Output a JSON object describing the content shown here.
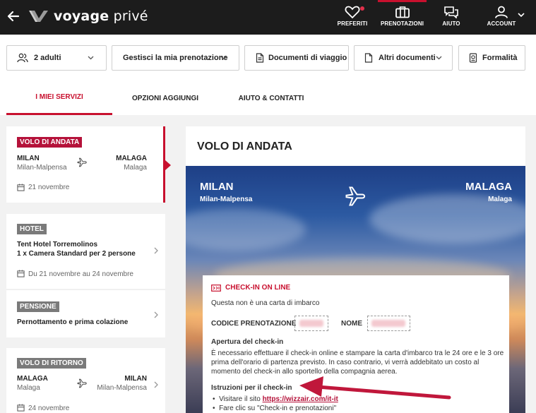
{
  "brand": {
    "name": "voyage",
    "name_suffix": "privé",
    "accent": "#c8102e"
  },
  "nav": {
    "preferiti": "PREFERITI",
    "prenotazioni": "PRENOTAZIONI",
    "aiuto": "AIUTO",
    "account": "ACCOUNT"
  },
  "actions": {
    "adults": "2 adulti",
    "manage": "Gestisci la mia prenotazione",
    "travel_docs": "Documenti di viaggio",
    "other_docs": "Altri documenti",
    "formalities": "Formalità"
  },
  "tabs": [
    {
      "label": "I MIEI SERVIZI"
    },
    {
      "label": "OPZIONI AGGIUNGI"
    },
    {
      "label": "AIUTO & CONTATTI"
    }
  ],
  "outbound_card": {
    "badge": "VOLO DI ANDATA",
    "from_city": "MILAN",
    "from_airport": "Milan-Malpensa",
    "to_city": "MALAGA",
    "to_airport": "Malaga",
    "date": "21 novembre"
  },
  "hotel_card": {
    "badge": "HOTEL",
    "name": "Tent Hotel Torremolinos",
    "room": "1 x Camera Standard per 2 persone",
    "dates": "Du 21 novembre au 24 novembre"
  },
  "pension_card": {
    "badge": "PENSIONE",
    "description": "Pernottamento e prima colazione"
  },
  "return_card": {
    "badge": "VOLO DI RITORNO",
    "from_city": "MALAGA",
    "from_airport": "Malaga",
    "to_city": "MILAN",
    "to_airport": "Milan-Malpensa",
    "date": "24 novembre"
  },
  "main": {
    "title": "VOLO DI ANDATA",
    "from_city": "MILAN",
    "from_airport": "Milan-Malpensa",
    "to_city": "MALAGA",
    "to_airport": "Malaga"
  },
  "checkin": {
    "title": "CHECK-IN ON LINE",
    "note": "Questa non è una carta di imbarco",
    "booking_code_label": "CODICE PRENOTAZIONE",
    "name_label": "NOME",
    "opening_title": "Apertura del check-in",
    "opening_text": "È necessario effettuare il check-in online e stampare la carta d'imbarco tra le 24 ore e le 3 ore prima dell'orario di partenza previsto. In caso contrario, vi verrà addebitato un costo al momento del check-in allo sportello della compagnia aerea.",
    "instructions_title": "Istruzioni per il check-in",
    "step1_prefix": "Visitare il sito",
    "step1_link": "https://wizzair.com/it-it",
    "step2": "Fare clic su \"Check-in e prenotazioni\""
  }
}
